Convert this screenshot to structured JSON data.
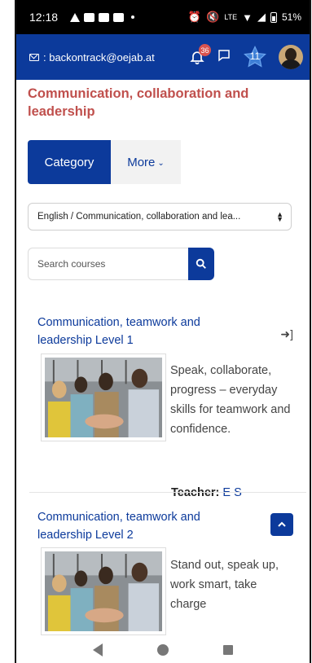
{
  "status_bar": {
    "time": "12:18",
    "battery": "51%",
    "left_icons": [
      "warning-icon",
      "notification-square-icon",
      "notification-square-icon",
      "notification-square-icon",
      "dot-icon"
    ],
    "right_icons": [
      "alarm-icon",
      "mute-icon",
      "volte-icon",
      "wifi-icon",
      "signal-icon",
      "battery-icon"
    ]
  },
  "header": {
    "email": ": backontrack@oejab.at",
    "notification_count": "36",
    "star_count": "11",
    "accent": "#0c3a9b"
  },
  "page": {
    "title": "Communication, collaboration and leadership",
    "title_color": "#c0504d"
  },
  "tabs": {
    "category": "Category",
    "more": "More"
  },
  "category_select": {
    "selected": "English / Communication, collaboration and lea..."
  },
  "search": {
    "placeholder": "Search courses"
  },
  "courses": [
    {
      "title": "Communication, teamwork and leadership Level 1",
      "summary": "Speak, collaborate, progress – everyday skills for teamwork and confidence.",
      "teacher_label": "Teacher:",
      "teacher_name": "E S"
    },
    {
      "title": "Communication, teamwork and leadership Level 2",
      "summary": "Stand out, speak up, work smart, take charge"
    }
  ]
}
